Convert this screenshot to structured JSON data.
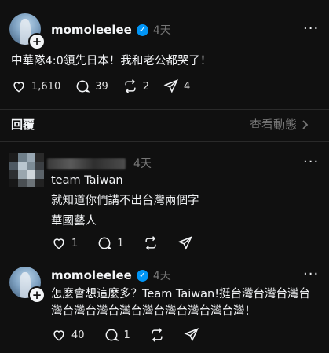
{
  "post": {
    "username": "momoleelee",
    "time": "4天",
    "text": "中華隊4:0領先日本！我和老公都哭了！",
    "likes": "1,610",
    "comments": "39",
    "reposts": "2",
    "shares": "4"
  },
  "replies_header": {
    "title": "回覆",
    "view_activity": "查看動態"
  },
  "reply1": {
    "time": "4天",
    "lines": [
      "team Taiwan",
      "就知道你們講不出台灣兩個字",
      "華國藝人"
    ],
    "likes": "1",
    "comments": "1"
  },
  "reply2": {
    "username": "momoleelee",
    "time": "4天",
    "line1": "怎麼會想這麼多？Team Taiwan!挺台灣台灣台灣台",
    "line2": "灣台灣台灣台灣台灣台灣台灣台灣台灣！",
    "likes": "40",
    "comments": "1"
  },
  "colors": {
    "background": "#101010",
    "text": "#f3f5f7",
    "muted": "#777777",
    "verified": "#0095f6"
  }
}
